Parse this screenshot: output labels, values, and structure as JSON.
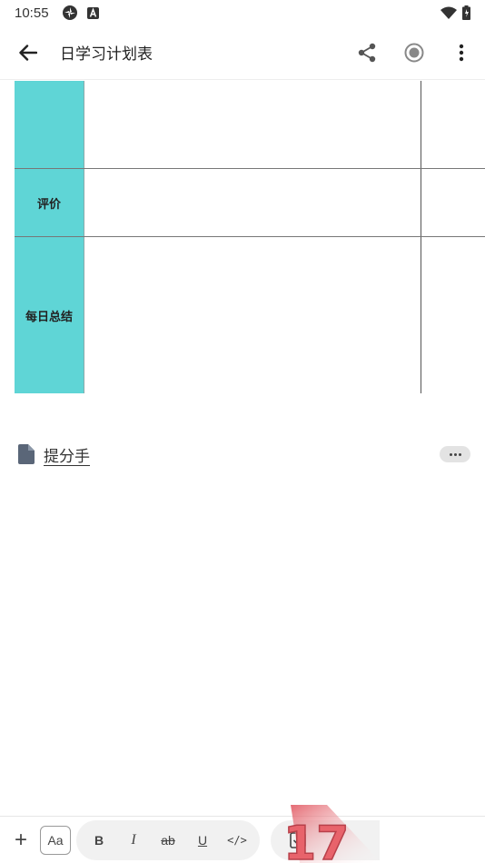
{
  "status_bar": {
    "time": "10:55",
    "left_icons": [
      "pinwheel-icon",
      "a-badge-icon"
    ],
    "right_icons": [
      "wifi-icon",
      "battery-icon"
    ]
  },
  "app_bar": {
    "back_icon": "arrow-back-icon",
    "title": "日学习计划表",
    "actions": [
      "share-icon",
      "record-icon",
      "more-vert-icon"
    ]
  },
  "table": {
    "header_color": "#5fd5d6",
    "rows": [
      {
        "label": ""
      },
      {
        "label": "评价"
      },
      {
        "label": "每日总结"
      }
    ]
  },
  "attachment": {
    "icon": "file-icon",
    "name": "提分手",
    "menu_icon": "more-horiz-icon"
  },
  "toolbar": {
    "add_label": "+",
    "font_label": "Aa",
    "bold_label": "B",
    "italic_label": "I",
    "strike_label": "ab",
    "underline_label": "U",
    "code_label": "</>",
    "checkbox_icon": "checkbox-icon"
  },
  "watermark": {
    "text": "17"
  }
}
